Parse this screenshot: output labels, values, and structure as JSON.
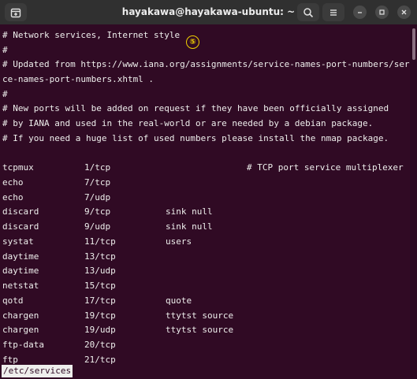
{
  "window": {
    "title": "hayakawa@hayakawa-ubuntu: ~",
    "icons": {
      "new_tab": "new-tab-icon",
      "search": "search-icon",
      "menu": "hamburger-menu-icon",
      "minimize": "minimize-icon",
      "maximize": "maximize-icon",
      "close": "close-icon"
    }
  },
  "marker": {
    "label": "⑤",
    "color": "#f0d000"
  },
  "header_lines": [
    "# Network services, Internet style",
    "#",
    "# Updated from https://www.iana.org/assignments/service-names-port-numbers/servi",
    "ce-names-port-numbers.xhtml .",
    "#",
    "# New ports will be added on request if they have been officially assigned",
    "# by IANA and used in the real-world or are needed by a debian package.",
    "# If you need a huge list of used numbers please install the nmap package.",
    ""
  ],
  "services": [
    {
      "name": "tcpmux",
      "port": "1/tcp",
      "alias": "",
      "comment": "# TCP port service multiplexer"
    },
    {
      "name": "echo",
      "port": "7/tcp",
      "alias": "",
      "comment": ""
    },
    {
      "name": "echo",
      "port": "7/udp",
      "alias": "",
      "comment": ""
    },
    {
      "name": "discard",
      "port": "9/tcp",
      "alias": "sink null",
      "comment": ""
    },
    {
      "name": "discard",
      "port": "9/udp",
      "alias": "sink null",
      "comment": ""
    },
    {
      "name": "systat",
      "port": "11/tcp",
      "alias": "users",
      "comment": ""
    },
    {
      "name": "daytime",
      "port": "13/tcp",
      "alias": "",
      "comment": ""
    },
    {
      "name": "daytime",
      "port": "13/udp",
      "alias": "",
      "comment": ""
    },
    {
      "name": "netstat",
      "port": "15/tcp",
      "alias": "",
      "comment": ""
    },
    {
      "name": "qotd",
      "port": "17/tcp",
      "alias": "quote",
      "comment": ""
    },
    {
      "name": "chargen",
      "port": "19/tcp",
      "alias": "ttytst source",
      "comment": ""
    },
    {
      "name": "chargen",
      "port": "19/udp",
      "alias": "ttytst source",
      "comment": ""
    },
    {
      "name": "ftp-data",
      "port": "20/tcp",
      "alias": "",
      "comment": ""
    },
    {
      "name": "ftp",
      "port": "21/tcp",
      "alias": "",
      "comment": ""
    }
  ],
  "status_line": "/etc/services"
}
